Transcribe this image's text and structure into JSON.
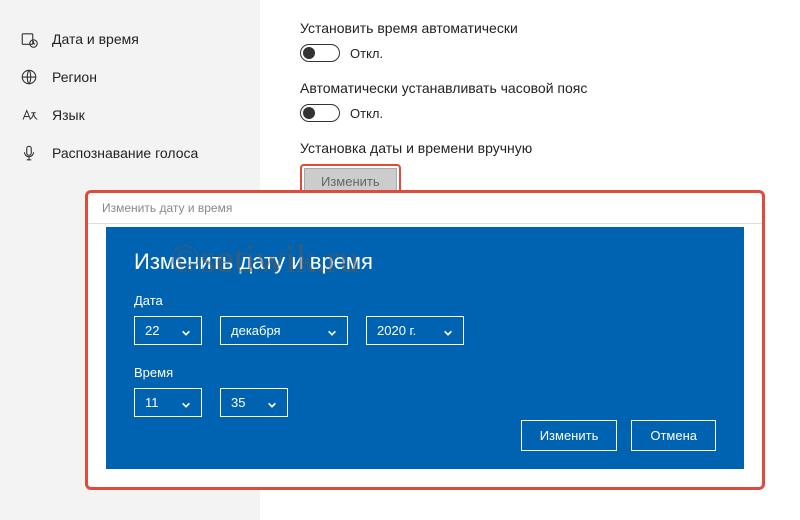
{
  "sidebar": {
    "items": [
      {
        "label": "Дата и время",
        "icon": "calendar-clock-icon"
      },
      {
        "label": "Регион",
        "icon": "globe-icon"
      },
      {
        "label": "Язык",
        "icon": "language-icon"
      },
      {
        "label": "Распознавание голоса",
        "icon": "microphone-icon"
      }
    ]
  },
  "settings": {
    "auto_time": {
      "label": "Установить время автоматически",
      "state": "Откл."
    },
    "auto_tz": {
      "label": "Автоматически устанавливать часовой пояс",
      "state": "Откл."
    },
    "manual": {
      "label": "Установка даты и времени вручную",
      "button": "Изменить"
    }
  },
  "dialog": {
    "titlebar": "Изменить дату и время",
    "heading": "Изменить дату и время",
    "date_label": "Дата",
    "date": {
      "day": "22",
      "month": "декабря",
      "year": "2020 г."
    },
    "time_label": "Время",
    "time": {
      "hour": "11",
      "minute": "35"
    },
    "actions": {
      "change": "Изменить",
      "cancel": "Отмена"
    }
  },
  "watermark": "©setiwik.ru"
}
